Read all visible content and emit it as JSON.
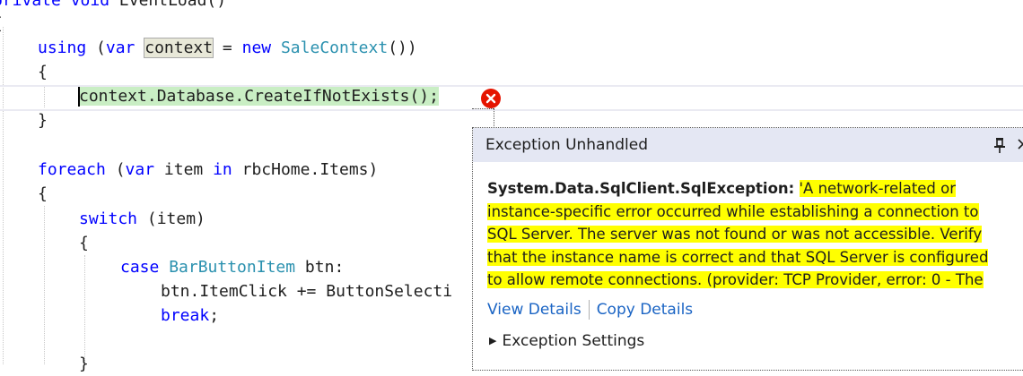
{
  "code": {
    "line0": {
      "kw": "private void ",
      "name": "EventLoad()"
    },
    "line1": "{",
    "line2": {
      "kw1": "using",
      "p1": " (",
      "kw2": "var",
      "sp": " ",
      "ref": "context",
      "p2": " = ",
      "kw3": "new",
      "sp2": " ",
      "type": "SaleContext",
      "p3": "())"
    },
    "line3": "{",
    "line4": "context.Database.CreateIfNotExists();",
    "line5": "}",
    "line6": {
      "kw1": "foreach",
      "p1": " (",
      "kw2": "var",
      "p2": " item ",
      "kw3": "in",
      "p3": " rbcHome.Items)"
    },
    "line7": "{",
    "line8": {
      "kw": "switch",
      "rest": " (item)"
    },
    "line9": "{",
    "line10": {
      "kw": "case",
      "sp": " ",
      "type": "BarButtonItem",
      "rest": " btn:"
    },
    "line11": "btn.ItemClick += ButtonSelecti",
    "line12": {
      "kw": "break",
      "rest": ";"
    },
    "line13": "}"
  },
  "exception": {
    "title": "Exception Unhandled",
    "type": "System.Data.SqlClient.SqlException:",
    "message": "'A network-related or instance-specific error occurred while establishing a connection to SQL Server. The server was not found or was not accessible. Verify that the instance name is correct and that SQL Server is configured to allow remote connections. (provider: TCP Provider, error: 0 - The",
    "view_details": "View Details",
    "copy_details": "Copy Details",
    "settings": "Exception Settings"
  },
  "colors": {
    "keyword": "#0000ff",
    "type": "#2b91af",
    "error": "#e51400",
    "highlight": "#ffff00",
    "link": "#1a64c4"
  }
}
